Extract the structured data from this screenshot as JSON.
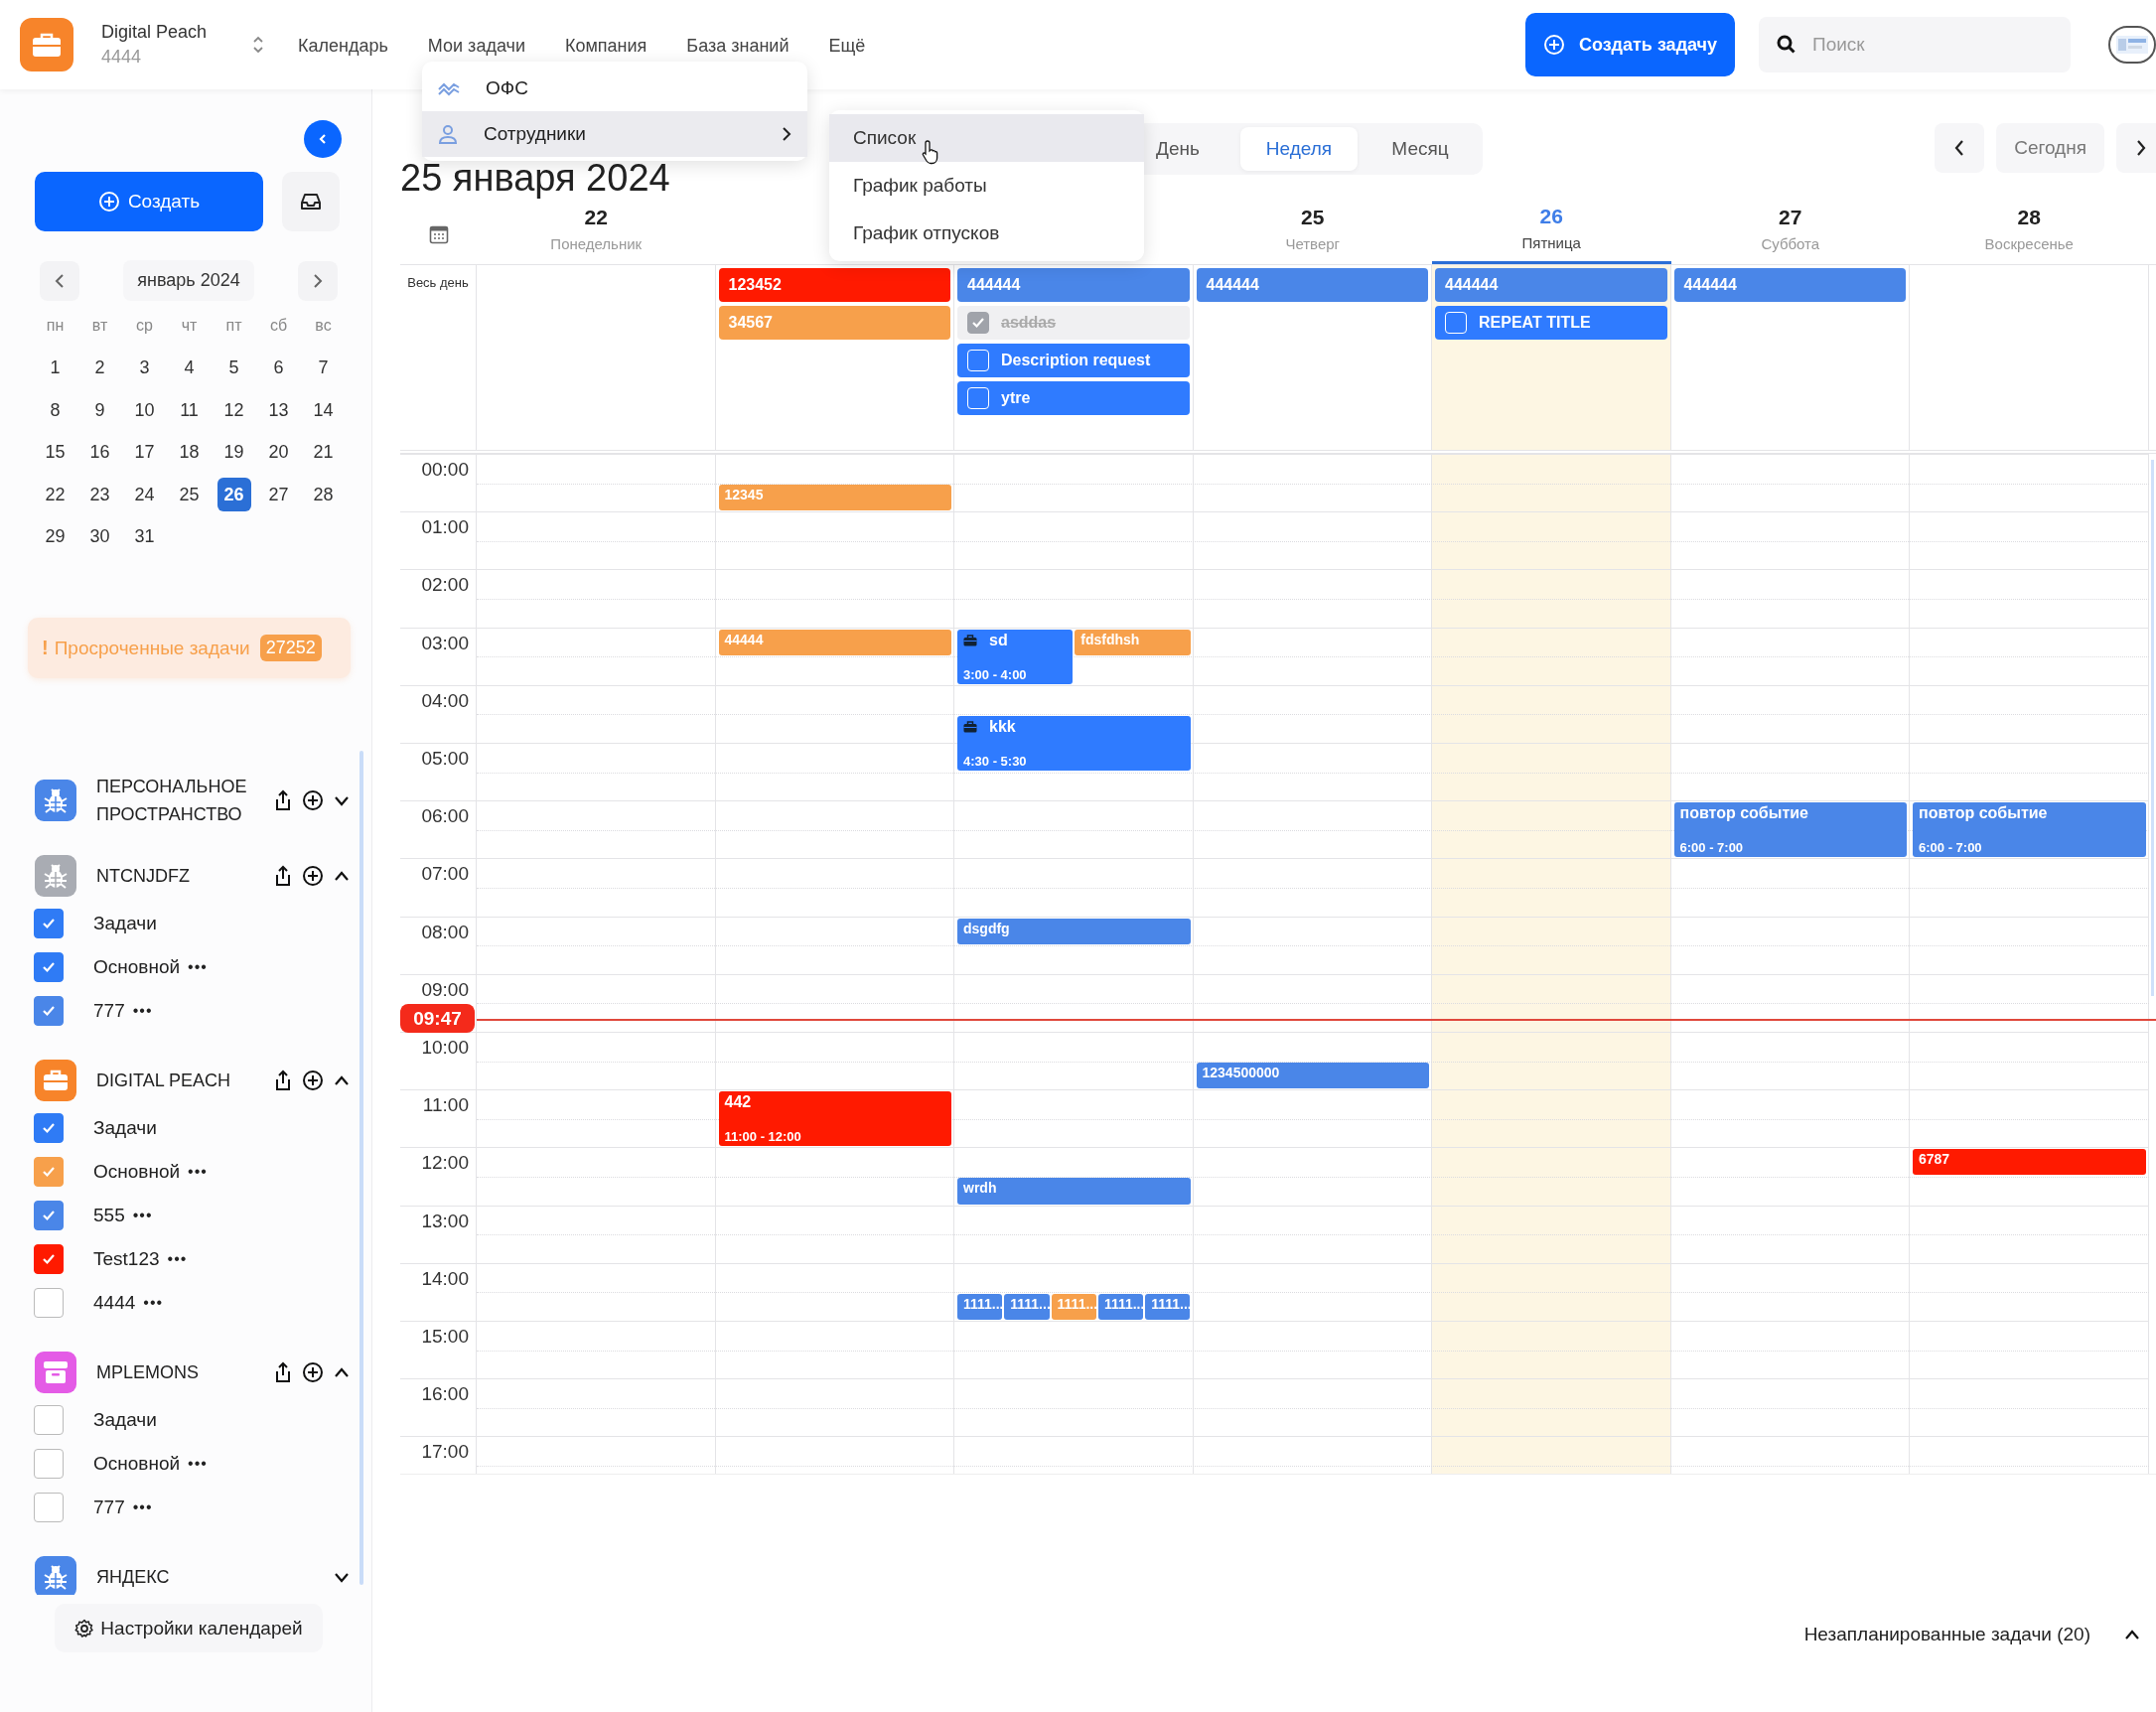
{
  "brand": {
    "name": "Digital Peach",
    "sub": "4444"
  },
  "nav": [
    "Календарь",
    "Мои задачи",
    "Компания",
    "База знаний",
    "Ещё"
  ],
  "create_task_button": "Создать задачу",
  "search": {
    "placeholder": "Поиск"
  },
  "menu": {
    "items": [
      {
        "label": "ОФС",
        "kind": "wave",
        "highlighted": false,
        "submenu": false
      },
      {
        "label": "Сотрудники",
        "kind": "person",
        "highlighted": true,
        "submenu": true
      }
    ]
  },
  "submenu": {
    "items": [
      {
        "label": "Список",
        "highlighted": true
      },
      {
        "label": "График работы",
        "highlighted": false
      },
      {
        "label": "График отпусков",
        "highlighted": false
      }
    ]
  },
  "sidebar": {
    "create_button": "Создать",
    "month_label": "январь 2024",
    "weekdays": [
      "пн",
      "вт",
      "ср",
      "чт",
      "пт",
      "сб",
      "вс"
    ],
    "weeks": [
      [
        {
          "day": "1",
          "selected": false
        },
        {
          "day": "2",
          "selected": false
        },
        {
          "day": "3",
          "selected": false
        },
        {
          "day": "4",
          "selected": false
        },
        {
          "day": "5",
          "selected": false
        },
        {
          "day": "6",
          "selected": false
        },
        {
          "day": "7",
          "selected": false
        }
      ],
      [
        {
          "day": "8",
          "selected": false
        },
        {
          "day": "9",
          "selected": false
        },
        {
          "day": "10",
          "selected": false
        },
        {
          "day": "11",
          "selected": false
        },
        {
          "day": "12",
          "selected": false
        },
        {
          "day": "13",
          "selected": false
        },
        {
          "day": "14",
          "selected": false
        }
      ],
      [
        {
          "day": "15",
          "selected": false
        },
        {
          "day": "16",
          "selected": false
        },
        {
          "day": "17",
          "selected": false
        },
        {
          "day": "18",
          "selected": false
        },
        {
          "day": "19",
          "selected": false
        },
        {
          "day": "20",
          "selected": false
        },
        {
          "day": "21",
          "selected": false
        }
      ],
      [
        {
          "day": "22",
          "selected": false
        },
        {
          "day": "23",
          "selected": false
        },
        {
          "day": "24",
          "selected": false
        },
        {
          "day": "25",
          "selected": false
        },
        {
          "day": "26",
          "selected": true
        },
        {
          "day": "27",
          "selected": false
        },
        {
          "day": "28",
          "selected": false
        }
      ],
      [
        {
          "day": "29",
          "selected": false
        },
        {
          "day": "30",
          "selected": false
        },
        {
          "day": "31",
          "selected": false
        }
      ]
    ],
    "overdue": {
      "mark": "!",
      "label": "Просроченные задачи",
      "count": "27252"
    },
    "calendars": [
      {
        "name": "ПЕРСОНАЛЬНОЕ ПРОСТРАНСТВО",
        "kind": "bug",
        "color": "#4a86e8",
        "actions": true,
        "expanded": false
      },
      {
        "name": "NTCNJDFZ",
        "kind": "bug",
        "color": "#a9acb3",
        "actions": true,
        "expanded": true,
        "items": [
          {
            "label": "Задачи",
            "checked": true,
            "color": "#2f7bf5"
          },
          {
            "label": "Основной",
            "more": "•••",
            "checked": true,
            "color": "#2f7bf5"
          },
          {
            "label": "777",
            "more": "•••",
            "checked": true,
            "color": "#4a86e8"
          }
        ]
      },
      {
        "name": "DIGITAL PEACH",
        "kind": "briefcase",
        "color": "#f7842a",
        "actions": true,
        "expanded": true,
        "items": [
          {
            "label": "Задачи",
            "checked": true,
            "color": "#2f7bf5"
          },
          {
            "label": "Основной",
            "more": "•••",
            "checked": true,
            "color": "#f7a04b"
          },
          {
            "label": "555",
            "more": "•••",
            "checked": true,
            "color": "#4a86e8"
          },
          {
            "label": "Test123",
            "more": "•••",
            "checked": true,
            "color": "#ff1a00"
          },
          {
            "label": "4444",
            "more": "•••",
            "checked": false
          }
        ]
      },
      {
        "name": "MPLEMONS",
        "kind": "archive",
        "color": "#e45be6",
        "actions": true,
        "expanded": true,
        "items": [
          {
            "label": "Задачи",
            "checked": false
          },
          {
            "label": "Основной",
            "more": "•••",
            "checked": false
          },
          {
            "label": "777",
            "more": "•••",
            "checked": false
          }
        ]
      },
      {
        "name": "ЯНДЕКС",
        "kind": "bug",
        "color": "#4a86e8",
        "actions": false,
        "expanded": false
      }
    ],
    "settings_button": "Настройки календарей"
  },
  "title": "25 января 2024",
  "views": [
    {
      "label": "День",
      "selected": false
    },
    {
      "label": "Неделя",
      "selected": true
    },
    {
      "label": "Месяц",
      "selected": false
    }
  ],
  "today_button": "Сегодня",
  "all_day_label": "Весь день",
  "days": [
    {
      "number": "22",
      "weekday": "Понедельник",
      "today": false
    },
    {
      "today": false,
      "all_day": [
        {
          "kind": "bar",
          "title": "123452",
          "color": "#ff1a00"
        },
        {
          "kind": "bar",
          "title": "34567",
          "color": "#f7a04b"
        }
      ]
    },
    {
      "today": false,
      "all_day": [
        {
          "kind": "bar",
          "title": "444444",
          "color": "#4a86e8"
        },
        {
          "kind": "task",
          "title": "asddas",
          "checked": true,
          "color": "#f0f0f2"
        },
        {
          "kind": "task",
          "title": "Description request",
          "checked": false,
          "color": "#2f7bff"
        },
        {
          "kind": "task",
          "title": "ytre",
          "checked": false,
          "color": "#2f7bff"
        }
      ]
    },
    {
      "number": "25",
      "weekday": "Четверг",
      "today": false,
      "all_day": [
        {
          "kind": "bar",
          "title": "444444",
          "color": "#4a86e8"
        }
      ]
    },
    {
      "number": "26",
      "weekday": "Пятница",
      "today": true,
      "all_day": [
        {
          "kind": "bar",
          "title": "444444",
          "color": "#4a86e8"
        },
        {
          "kind": "task",
          "title": "REPEAT TITLE",
          "checked": false,
          "color": "#2f7bff"
        }
      ]
    },
    {
      "number": "27",
      "weekday": "Суббота",
      "today": false,
      "all_day": [
        {
          "kind": "bar",
          "title": "444444",
          "color": "#4a86e8"
        }
      ]
    },
    {
      "number": "28",
      "weekday": "Воскресенье",
      "today": false
    }
  ],
  "hours": [
    {
      "label": "00:00",
      "cells": [
        {},
        {
          "bottom_half": [
            {
              "kind": "short",
              "title": "12345",
              "color": "#f7a04b",
              "briefcase": false
            }
          ]
        },
        {},
        {},
        {},
        {},
        {}
      ]
    },
    {
      "label": "01:00"
    },
    {
      "label": "02:00"
    },
    {
      "label": "03:00",
      "cells": [
        {},
        {
          "top_half": [
            {
              "kind": "short",
              "title": "44444",
              "color": "#f7a04b",
              "briefcase": false
            }
          ]
        },
        {
          "top_half": [
            {
              "kind": "long",
              "title": "sd",
              "time": "3:00 - 4:00",
              "color": "#2f7bff",
              "briefcase": true
            },
            {
              "kind": "short",
              "title": "fdsfdhsh",
              "color": "#f7a04b",
              "briefcase": false
            }
          ]
        },
        {},
        {},
        {},
        {}
      ]
    },
    {
      "label": "04:00",
      "cells": [
        {},
        {},
        {
          "bottom_half": [
            {
              "kind": "long",
              "title": "kkk",
              "time": "4:30 - 5:30",
              "color": "#2f7bff",
              "briefcase": true
            }
          ]
        },
        {},
        {},
        {},
        {}
      ]
    },
    {
      "label": "05:00"
    },
    {
      "label": "06:00",
      "cells": [
        {},
        {},
        {},
        {},
        {},
        {
          "top_half": [
            {
              "kind": "long",
              "title": "повтор событие",
              "time": "6:00 - 7:00",
              "color": "#4a86e8",
              "briefcase": false
            }
          ]
        },
        {
          "top_half": [
            {
              "kind": "long",
              "title": "повтор событие",
              "time": "6:00 - 7:00",
              "color": "#4a86e8",
              "briefcase": false
            }
          ]
        }
      ]
    },
    {
      "label": "07:00"
    },
    {
      "label": "08:00",
      "cells": [
        {},
        {},
        {
          "top_half": [
            {
              "kind": "short",
              "title": "dsgdfg",
              "color": "#4a86e8",
              "briefcase": false
            }
          ]
        },
        {},
        {},
        {},
        {}
      ]
    },
    {
      "label": "09:00"
    },
    {
      "label": "10:00",
      "cells": [
        {},
        {},
        {},
        {
          "bottom_half": [
            {
              "kind": "short",
              "title": "1234500000",
              "color": "#4a86e8",
              "briefcase": false
            }
          ]
        },
        {},
        {},
        {}
      ]
    },
    {
      "label": "11:00",
      "cells": [
        {},
        {
          "top_half": [
            {
              "kind": "long",
              "title": "442",
              "time": "11:00 - 12:00",
              "color": "#ff1a00",
              "briefcase": false
            }
          ]
        },
        {},
        {},
        {},
        {},
        {}
      ]
    },
    {
      "label": "12:00",
      "cells": [
        {},
        {},
        {
          "bottom_half": [
            {
              "kind": "short",
              "title": "wrdh",
              "color": "#4a86e8",
              "briefcase": false
            }
          ]
        },
        {},
        {},
        {},
        {
          "top_half": [
            {
              "kind": "short",
              "title": "6787",
              "color": "#ff1a00",
              "briefcase": false
            }
          ]
        }
      ]
    },
    {
      "label": "13:00"
    },
    {
      "label": "14:00",
      "cells": [
        {},
        {},
        {
          "bottom_half": [
            {
              "kind": "short",
              "title": "1111...",
              "color": "#4a86e8",
              "briefcase": false
            },
            {
              "kind": "short",
              "title": "1111...",
              "color": "#4a86e8",
              "briefcase": false
            },
            {
              "kind": "short",
              "title": "1111...",
              "color": "#f7a04b",
              "briefcase": false
            },
            {
              "kind": "short",
              "title": "1111...",
              "color": "#4a86e8",
              "briefcase": false
            },
            {
              "kind": "short",
              "title": "1111...",
              "color": "#4a86e8",
              "briefcase": false
            }
          ]
        },
        {},
        {},
        {},
        {}
      ]
    },
    {
      "label": "15:00"
    },
    {
      "label": "16:00"
    },
    {
      "label": "17:00"
    }
  ],
  "now": {
    "label": "09:47"
  },
  "unscheduled": "Незапланированные задачи (20)"
}
